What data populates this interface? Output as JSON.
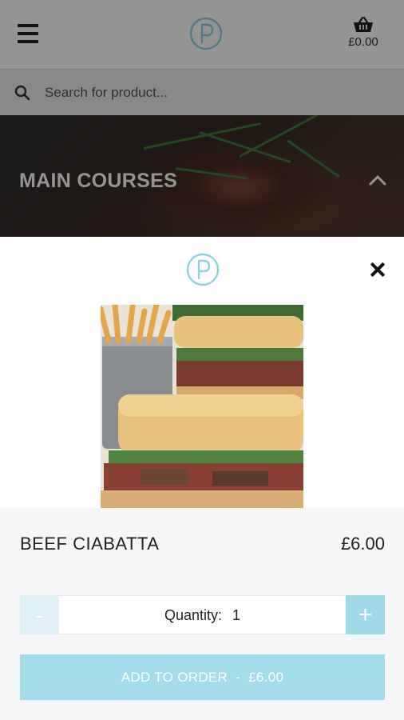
{
  "header": {
    "menu_icon": "hamburger-menu-icon",
    "logo_icon": "p-logo-icon",
    "basket_icon": "basket-icon",
    "basket_total": "£0.00"
  },
  "search": {
    "placeholder": "Search for product...",
    "icon": "search-icon"
  },
  "category": {
    "title": "MAIN COURSES",
    "toggle_icon": "chevron-up-icon"
  },
  "modal": {
    "logo_icon": "p-logo-icon",
    "close_icon": "close-icon",
    "product": {
      "name": "BEEF CIABATTA",
      "price": "£6.00",
      "quantity_label": "Quantity:",
      "quantity": "1",
      "minus_label": "-",
      "plus_label": "+",
      "add_label": "ADD TO ORDER  -  £6.00"
    }
  },
  "colors": {
    "accent": "#a2dde9",
    "accent_light": "#dff1f6",
    "logo": "#8fd0e0"
  }
}
